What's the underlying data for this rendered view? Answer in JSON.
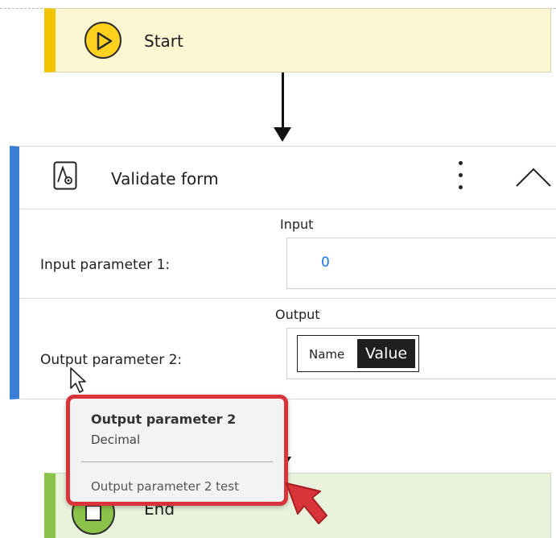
{
  "flow": {
    "start": {
      "label": "Start"
    },
    "action": {
      "title": "Validate form",
      "input_section": "Input",
      "input_param_label": "Input parameter 1:",
      "input_param_value": "0",
      "output_section": "Output",
      "output_param_label": "Output parameter 2:",
      "chip_name": "Name",
      "chip_value": "Value"
    },
    "end": {
      "label": "End"
    }
  },
  "tooltip": {
    "title": "Output parameter 2",
    "type": "Decimal",
    "description": "Output parameter 2 test"
  },
  "colors": {
    "start_accent": "#f2c400",
    "action_accent": "#3a7fd5",
    "end_accent": "#8bc34a",
    "highlight": "#d9343a",
    "value_text": "#1a73e8"
  },
  "icons": [
    "play-icon",
    "action-settings-icon",
    "more-vertical-icon",
    "chevron-up-icon",
    "stop-icon",
    "mouse-cursor-icon",
    "red-pointer-arrow-icon"
  ]
}
